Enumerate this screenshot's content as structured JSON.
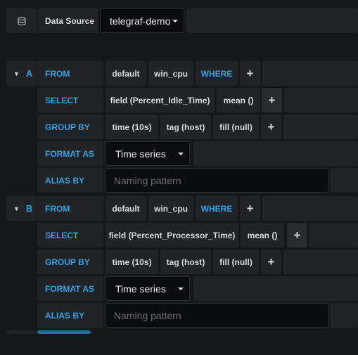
{
  "datasource": {
    "label": "Data Source",
    "value": "telegraf-demo",
    "icon": "database-icon"
  },
  "queries": [
    {
      "ref": "A",
      "from_label": "FROM",
      "policy": "default",
      "measurement": "win_cpu",
      "where": "WHERE",
      "select_label": "SELECT",
      "field": "field (Percent_Idle_Time)",
      "agg": "mean ()",
      "group_label": "GROUP BY",
      "time": "time (10s)",
      "tag": "tag (host)",
      "fill": "fill (null)",
      "format_label": "FORMAT AS",
      "format": "Time series",
      "alias_label": "ALIAS BY",
      "alias_placeholder": "Naming pattern"
    },
    {
      "ref": "B",
      "from_label": "FROM",
      "policy": "default",
      "measurement": "win_cpu",
      "where": "WHERE",
      "select_label": "SELECT",
      "field": "field (Percent_Processor_Time)",
      "agg": "mean ()",
      "group_label": "GROUP BY",
      "time": "time (10s)",
      "tag": "tag (host)",
      "fill": "fill (null)",
      "format_label": "FORMAT AS",
      "format": "Time series",
      "alias_label": "ALIAS BY",
      "alias_placeholder": "Naming pattern"
    }
  ],
  "plus": "+",
  "colors": {
    "accent": "#33a2e5",
    "panel": "#222327",
    "background": "#161719"
  }
}
